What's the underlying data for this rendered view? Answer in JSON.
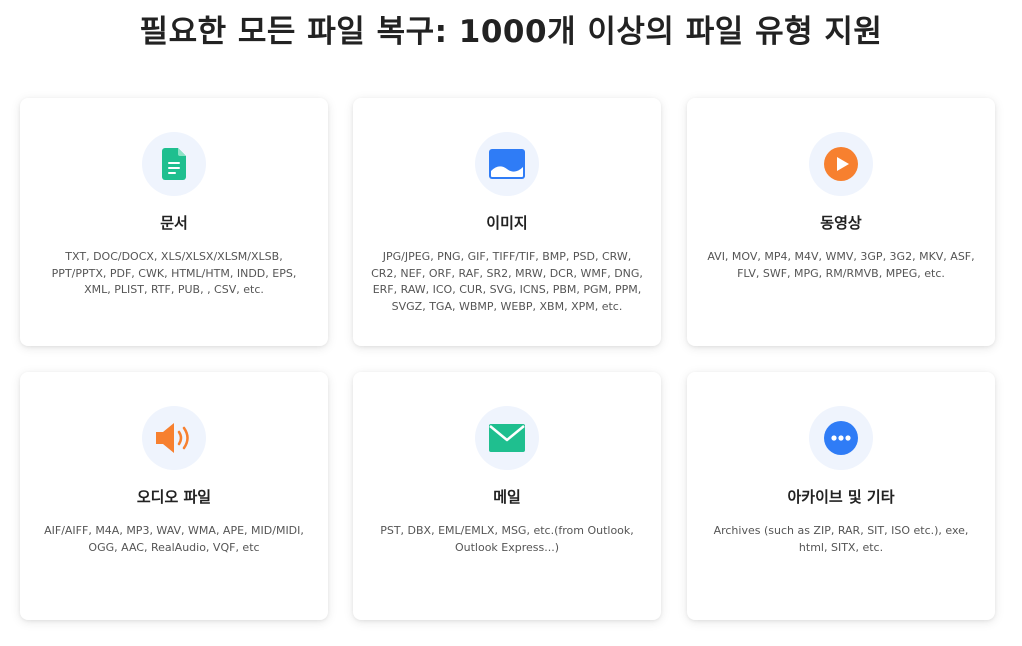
{
  "page": {
    "title": "필요한 모든 파일 복구: 1000개 이상의 파일 유형 지원"
  },
  "cards": [
    {
      "title": "문서",
      "description": "TXT, DOC/DOCX, XLS/XLSX/XLSM/XLSB, PPT/PPTX, PDF, CWK, HTML/HTM, INDD, EPS, XML, PLIST, RTF, PUB, , CSV, etc.",
      "icon": "document-icon",
      "color": "#1fbf8f"
    },
    {
      "title": "이미지",
      "description": "JPG/JPEG, PNG, GIF, TIFF/TIF, BMP, PSD, CRW, CR2, NEF, ORF, RAF, SR2, MRW, DCR, WMF, DNG, ERF, RAW, ICO, CUR, SVG, ICNS, PBM, PGM, PPM, SVGZ, TGA, WBMP, WEBP, XBM, XPM, etc.",
      "icon": "image-icon",
      "color": "#2f7cf6"
    },
    {
      "title": "동영상",
      "description": "AVI, MOV, MP4, M4V, WMV, 3GP, 3G2, MKV, ASF, FLV, SWF, MPG, RM/RMVB, MPEG, etc.",
      "icon": "video-play-icon",
      "color": "#f7802f"
    },
    {
      "title": "오디오 파일",
      "description": "AIF/AIFF, M4A, MP3, WAV, WMA, APE, MID/MIDI, OGG, AAC, RealAudio, VQF, etc",
      "icon": "speaker-icon",
      "color": "#f7802f"
    },
    {
      "title": "메일",
      "description": "PST, DBX, EML/EMLX, MSG, etc.(from Outlook, Outlook Express...)",
      "icon": "mail-icon",
      "color": "#1fbf8f"
    },
    {
      "title": "아카이브 및 기타",
      "description": "Archives (such as ZIP, RAR, SIT, ISO etc.), exe, html, SITX, etc.",
      "icon": "more-dots-icon",
      "color": "#2f7cf6"
    }
  ]
}
